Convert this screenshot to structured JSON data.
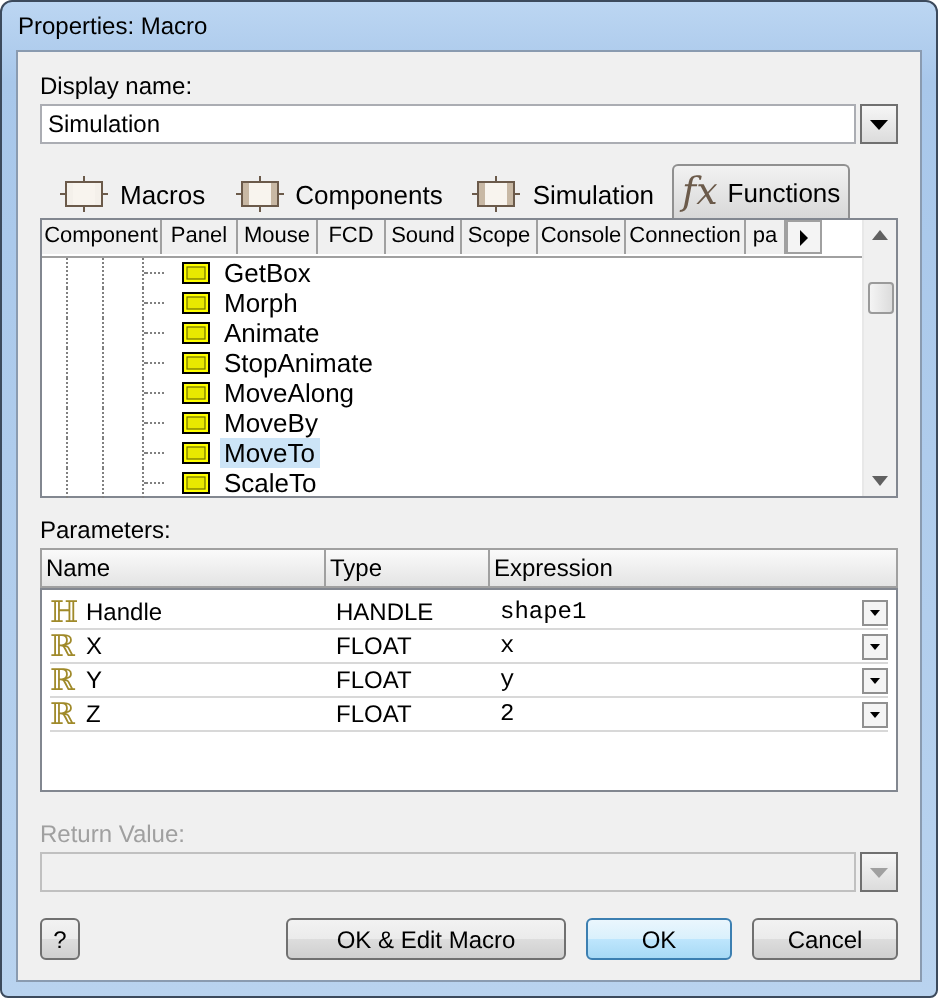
{
  "window": {
    "title": "Properties: Macro"
  },
  "display_name": {
    "label": "Display name:",
    "value": "Simulation"
  },
  "tabs": [
    {
      "label": "Macros",
      "kind": "plain",
      "selected": false
    },
    {
      "label": "Components",
      "kind": "hatched",
      "selected": false
    },
    {
      "label": "Simulation",
      "kind": "hatched",
      "selected": false
    },
    {
      "label": "Functions",
      "kind": "fx",
      "icon_text": "fx",
      "selected": true
    }
  ],
  "subtabs": [
    "Component",
    "Panel",
    "Mouse",
    "FCD",
    "Sound",
    "Scope",
    "Console",
    "Connection",
    "pa"
  ],
  "tree": {
    "items": [
      {
        "label": "GetBox",
        "selected": false
      },
      {
        "label": "Morph",
        "selected": false
      },
      {
        "label": "Animate",
        "selected": false
      },
      {
        "label": "StopAnimate",
        "selected": false
      },
      {
        "label": "MoveAlong",
        "selected": false
      },
      {
        "label": "MoveBy",
        "selected": false
      },
      {
        "label": "MoveTo",
        "selected": true
      },
      {
        "label": "ScaleTo",
        "selected": false
      }
    ]
  },
  "parameters": {
    "label": "Parameters:",
    "columns": [
      "Name",
      "Type",
      "Expression"
    ],
    "rows": [
      {
        "symbol": "ℍ",
        "name": "Handle",
        "type": "HANDLE",
        "expression": "shape1"
      },
      {
        "symbol": "ℝ",
        "name": "X",
        "type": "FLOAT",
        "expression": "x"
      },
      {
        "symbol": "ℝ",
        "name": "Y",
        "type": "FLOAT",
        "expression": "y"
      },
      {
        "symbol": "ℝ",
        "name": "Z",
        "type": "FLOAT",
        "expression": "2"
      }
    ]
  },
  "return_value": {
    "label": "Return Value:",
    "disabled": true
  },
  "help_button": "?",
  "buttons": [
    {
      "label": "OK & Edit Macro",
      "default": false
    },
    {
      "label": "OK",
      "default": true
    },
    {
      "label": "Cancel",
      "default": false
    }
  ]
}
